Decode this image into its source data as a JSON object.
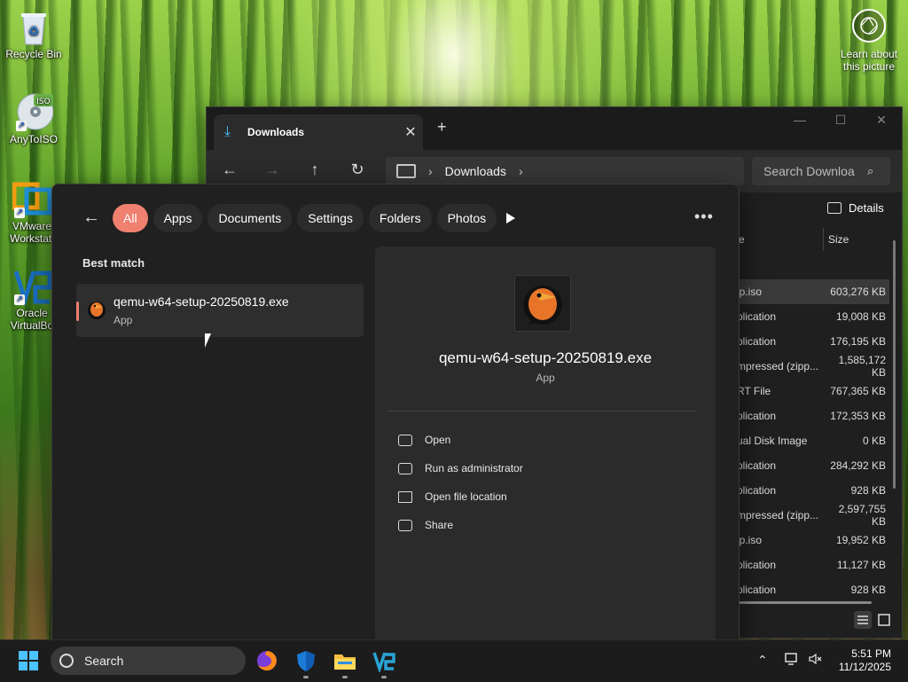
{
  "desktop": {
    "icons": [
      {
        "label": "Recycle Bin"
      },
      {
        "label": "AnyToISO",
        "badge": "ISO"
      },
      {
        "label": "VMware Workstati"
      },
      {
        "label": "Oracle VirtualBo"
      }
    ],
    "learn_label": "Learn about this picture"
  },
  "explorer": {
    "tab_label": "Downloads",
    "new_tab": "+",
    "address_crumb": "Downloads",
    "search_placeholder": "Search Downloa",
    "details_label": "Details",
    "columns": {
      "type": "e",
      "size": "Size"
    },
    "rows": [
      {
        "type": "ip.iso",
        "size": "603,276 KB"
      },
      {
        "type": "plication",
        "size": "19,008 KB"
      },
      {
        "type": "plication",
        "size": "176,195 KB"
      },
      {
        "type": "mpressed (zipp...",
        "size": "1,585,172 KB"
      },
      {
        "type": "RT File",
        "size": "767,365 KB"
      },
      {
        "type": "plication",
        "size": "172,353 KB"
      },
      {
        "type": "ual Disk Image",
        "size": "0 KB"
      },
      {
        "type": "plication",
        "size": "284,292 KB"
      },
      {
        "type": "plication",
        "size": "928 KB"
      },
      {
        "type": "mpressed (zipp...",
        "size": "2,597,755 KB"
      },
      {
        "type": "ip.iso",
        "size": "19,952 KB"
      },
      {
        "type": "plication",
        "size": "11,127 KB"
      },
      {
        "type": "plication",
        "size": "928 KB"
      }
    ]
  },
  "search_flyout": {
    "filters": [
      "All",
      "Apps",
      "Documents",
      "Settings",
      "Folders",
      "Photos"
    ],
    "active_filter": "All",
    "best_match_label": "Best match",
    "result": {
      "name": "qemu-w64-setup-20250819.exe",
      "kind": "App"
    },
    "preview": {
      "name": "qemu-w64-setup-20250819.exe",
      "kind": "App"
    },
    "actions": [
      {
        "label": "Open",
        "icon": "open-external-icon"
      },
      {
        "label": "Run as administrator",
        "icon": "shield-admin-icon"
      },
      {
        "label": "Open file location",
        "icon": "folder-icon"
      },
      {
        "label": "Share",
        "icon": "share-icon"
      }
    ],
    "accent_color": "#f08070"
  },
  "taskbar": {
    "search_label": "Search",
    "time": "5:51 PM",
    "date": "11/12/2025",
    "apps": [
      "firefox-icon",
      "defender-shield-icon",
      "file-explorer-icon",
      "vmware-icon"
    ]
  }
}
